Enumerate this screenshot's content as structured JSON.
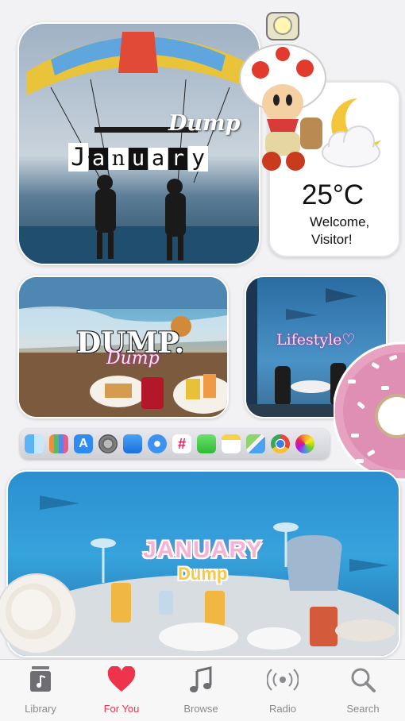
{
  "widget1": {
    "title_script": "Dump",
    "title_letters": [
      "J",
      "a",
      "n",
      "u",
      "a",
      "r",
      "y"
    ]
  },
  "weather": {
    "temperature": "25°C",
    "greeting_line1": "Welcome,",
    "greeting_line2": "Visitor!"
  },
  "widget2": {
    "title": "DUMP.",
    "subtitle": "Dump"
  },
  "widget3": {
    "title": "Lifestyle"
  },
  "widget4": {
    "line1": "JANUARY",
    "line2": "Dump"
  },
  "dock": {
    "apps": [
      "finder-icon",
      "launchpad-icon",
      "app-store-icon",
      "settings-icon",
      "mail-icon",
      "safari-icon",
      "slack-icon",
      "messages-icon",
      "notes-icon",
      "maps-icon",
      "chrome-icon",
      "photos-icon"
    ]
  },
  "tabs": [
    {
      "label": "Library",
      "icon": "library-icon"
    },
    {
      "label": "For You",
      "icon": "heart-icon",
      "active": true
    },
    {
      "label": "Browse",
      "icon": "music-note-icon"
    },
    {
      "label": "Radio",
      "icon": "radio-icon"
    },
    {
      "label": "Search",
      "icon": "search-icon"
    }
  ],
  "colors": {
    "accent": "#f0334c",
    "tab_inactive": "#8a8a8e",
    "background": "#f2f2f5"
  }
}
